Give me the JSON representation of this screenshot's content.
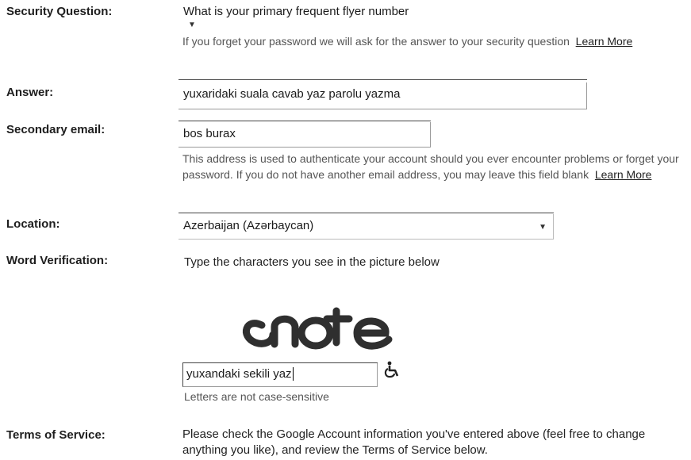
{
  "security_question": {
    "label": "Security Question:",
    "selected": "What is your primary frequent flyer number",
    "help_text": "If you forget your password we will ask for the answer to your security question",
    "learn_more": "Learn More"
  },
  "answer": {
    "label": "Answer:",
    "value": "yuxaridaki suala cavab yaz parolu yazma"
  },
  "secondary_email": {
    "label": "Secondary email:",
    "value": "bos burax",
    "help_text": "This address is used to authenticate your account should you ever encounter problems or forget your password. If you do not have another email address, you may leave this field blank",
    "learn_more": "Learn More"
  },
  "location": {
    "label": "Location:",
    "selected": "Azerbaijan (Azərbaycan)"
  },
  "word_verification": {
    "label": "Word Verification:",
    "instruction": "Type the characters you see in the picture below",
    "captcha_text": "cnote",
    "value": "yuxandaki sekili yaz",
    "note": "Letters are not case-sensitive",
    "accessibility_icon": "wheelchair-icon"
  },
  "terms": {
    "label": "Terms of Service:",
    "text": "Please check the Google Account information you've entered above (feel free to change anything you like), and review the Terms of Service below."
  }
}
